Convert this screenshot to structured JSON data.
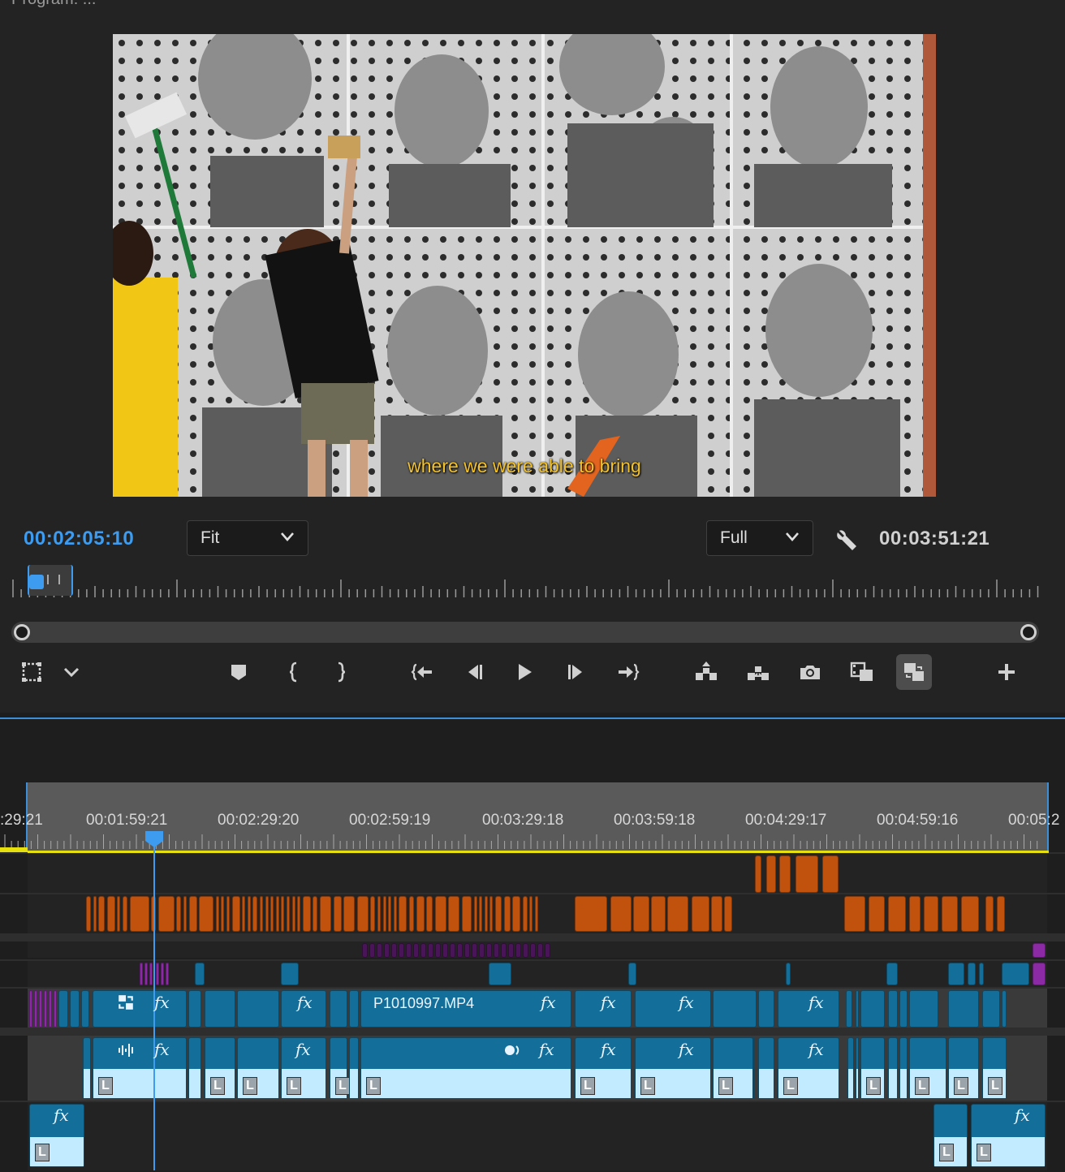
{
  "monitor": {
    "title": "Program: ...",
    "subtitle_caption": "where we were able to bring",
    "current_timecode": "00:02:05:10",
    "duration_timecode": "00:03:51:21",
    "zoom_select": "Fit",
    "resolution_select": "Full"
  },
  "transport": {
    "buttons": [
      "add-marker",
      "mark-in",
      "mark-out",
      "go-to-in",
      "step-back",
      "play",
      "step-forward",
      "go-to-out",
      "lift",
      "extract",
      "export-frame",
      "insert-frames",
      "compare-view",
      "add-button"
    ]
  },
  "timeline": {
    "ruler_labels": [
      ":29:21",
      "00:01:59:21",
      "00:02:29:20",
      "00:02:59:19",
      "00:03:29:18",
      "00:03:59:18",
      "00:04:29:17",
      "00:04:59:16",
      "00:05:2"
    ],
    "video_clip_name": "P1010997.MP4",
    "fx_label": "fx",
    "audio_channel_label": "L"
  },
  "colors": {
    "accent": "#3d9cf0",
    "clip_blue": "#136f9a",
    "clip_orange": "#c0520e",
    "clip_purple": "#8c2aa6",
    "waveform": "#c2ebff",
    "in_out_bar": "#e6e10e"
  }
}
